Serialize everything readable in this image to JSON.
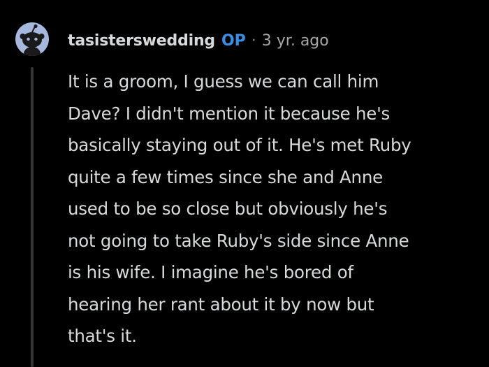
{
  "comment": {
    "author": "tasisterswedding",
    "op_badge": "OP",
    "separator": "·",
    "timestamp": "3 yr. ago",
    "avatar_icon": "snoo-avatar-icon",
    "lines": [
      "It is a groom, I guess we can call him",
      "Dave? I didn't mention it because he's",
      "basically staying out of it. He's met Ruby",
      "quite a few times since she and Anne",
      "used to be so close but obviously he's",
      "not going to take Ruby's side since Anne",
      "is his wife. I imagine he's bored of",
      "hearing her rant about it by now but",
      "that's it."
    ]
  },
  "colors": {
    "background": "#000000",
    "text": "#d7dadc",
    "op_badge": "#3a8fe6",
    "thread_line": "#343536",
    "avatar_bg": "#a6b8de"
  }
}
